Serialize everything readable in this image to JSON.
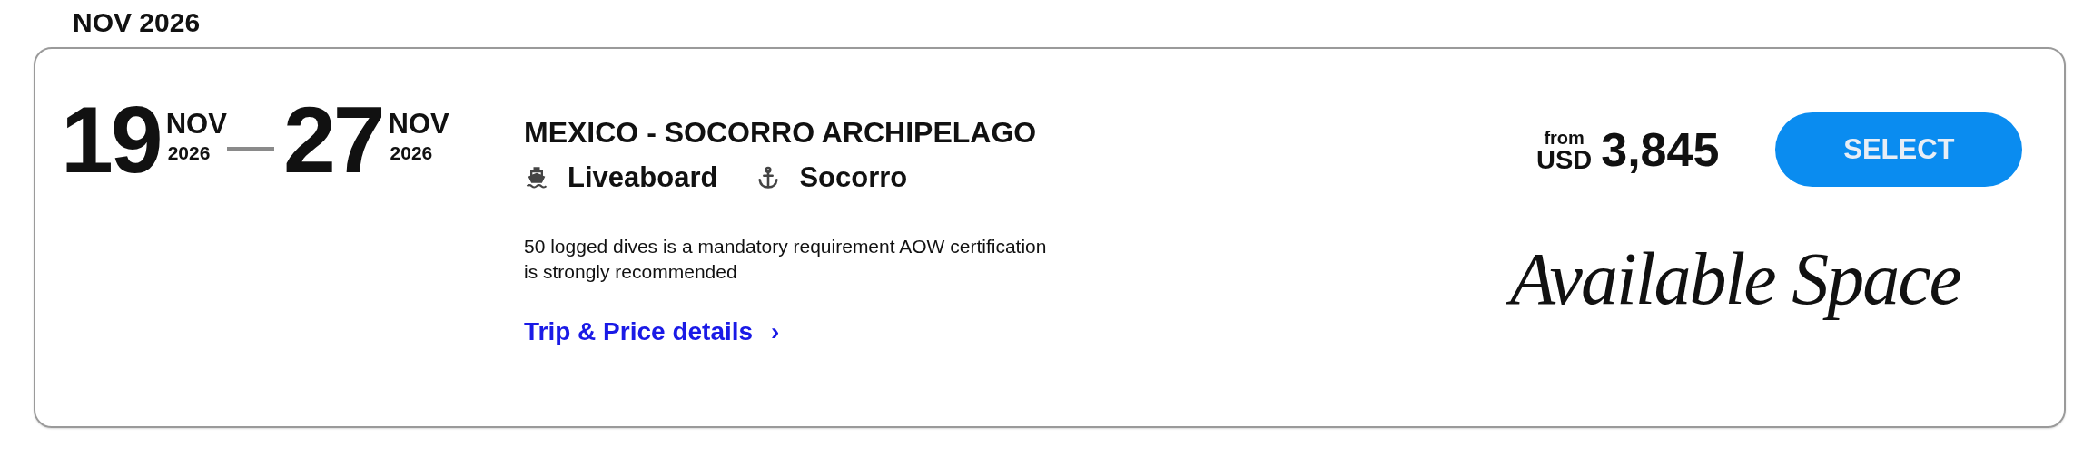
{
  "month_header": "NOV 2026",
  "trip": {
    "start": {
      "day": "19",
      "month": "NOV",
      "year": "2026"
    },
    "end": {
      "day": "27",
      "month": "NOV",
      "year": "2026"
    },
    "title": "MEXICO - SOCORRO ARCHIPELAGO",
    "tags": [
      {
        "kind": "boat",
        "label": "Liveaboard"
      },
      {
        "kind": "anchor",
        "label": "Socorro"
      }
    ],
    "note": "50 logged dives is a mandatory requirement AOW certification is strongly recommended",
    "details_link": "Trip & Price details",
    "details_chevron": "›",
    "price": {
      "prefix": "from",
      "currency": "USD",
      "amount": "3,845"
    },
    "select_button": "SELECT",
    "availability": "Available Space"
  }
}
